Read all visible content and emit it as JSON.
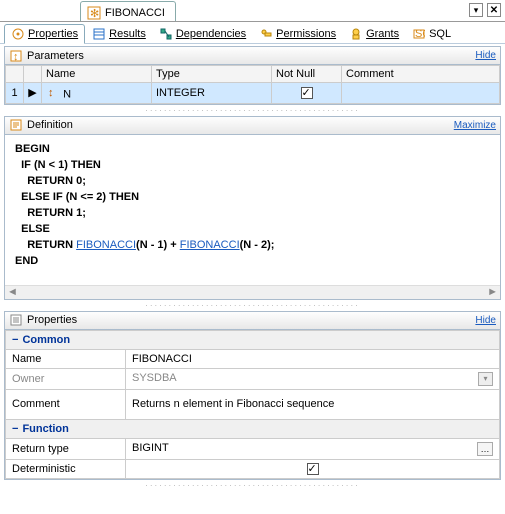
{
  "file_tab": {
    "title": "FIBONACCI"
  },
  "tab_actions": {
    "chev": "▾",
    "close": "✕"
  },
  "sub_tabs": {
    "properties": "Properties",
    "results": "Results",
    "dependencies": "Dependencies",
    "permissions": "Permissions",
    "grants": "Grants",
    "sql": "SQL"
  },
  "parameters": {
    "title": "Parameters",
    "hide": "Hide",
    "headers": {
      "idx": "",
      "mark": "",
      "name": "Name",
      "type": "Type",
      "notnull": "Not Null",
      "comment": "Comment"
    },
    "row": {
      "idx": "1",
      "name": "N",
      "type": "INTEGER",
      "notnull_checked": true,
      "comment": ""
    }
  },
  "definition": {
    "title": "Definition",
    "maximize": "Maximize",
    "lines": {
      "l0": "BEGIN",
      "l1": "  IF (N < 1) THEN",
      "l2": "    RETURN 0;",
      "l3": "  ELSE IF (N <= 2) THEN",
      "l4": "    RETURN 1;",
      "l5": "  ELSE",
      "l6a": "    RETURN ",
      "l6f1": "FIBONACCI",
      "l6b": "(N - 1) + ",
      "l6f2": "FIBONACCI",
      "l6c": "(N - 2);",
      "l7": "END"
    }
  },
  "properties": {
    "title": "Properties",
    "hide": "Hide",
    "common": {
      "label": "Common",
      "name_k": "Name",
      "name_v": "FIBONACCI",
      "owner_k": "Owner",
      "owner_v": "SYSDBA",
      "comment_k": "Comment",
      "comment_v": "Returns n element in Fibonacci sequence"
    },
    "function": {
      "label": "Function",
      "return_k": "Return type",
      "return_v": "BIGINT",
      "det_k": "Deterministic",
      "det_checked": true
    },
    "ellipsis": "…",
    "combo": "▾"
  }
}
